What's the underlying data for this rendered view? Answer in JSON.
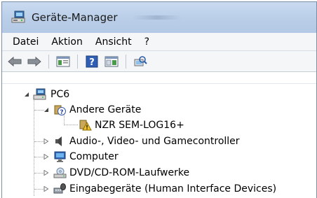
{
  "window": {
    "title": "Geräte-Manager",
    "accent": "#b9cde8"
  },
  "menu": {
    "items": [
      "Datei",
      "Aktion",
      "Ansicht",
      "?"
    ]
  },
  "toolbar": {
    "buttons": [
      "back-arrow-icon",
      "forward-arrow-icon",
      "properties-icon",
      "help-icon",
      "view-icon",
      "scan-hardware-icon"
    ]
  },
  "tree": {
    "root": "PC6",
    "category_other": "Andere Geräte",
    "device_unknown": "NZR SEM-LOG16+",
    "category_audio": "Audio-, Video- und Gamecontroller",
    "category_computer": "Computer",
    "category_dvd": "DVD/CD-ROM-Laufwerke",
    "category_input": "Eingabegeräte (Human Interface Devices)"
  }
}
